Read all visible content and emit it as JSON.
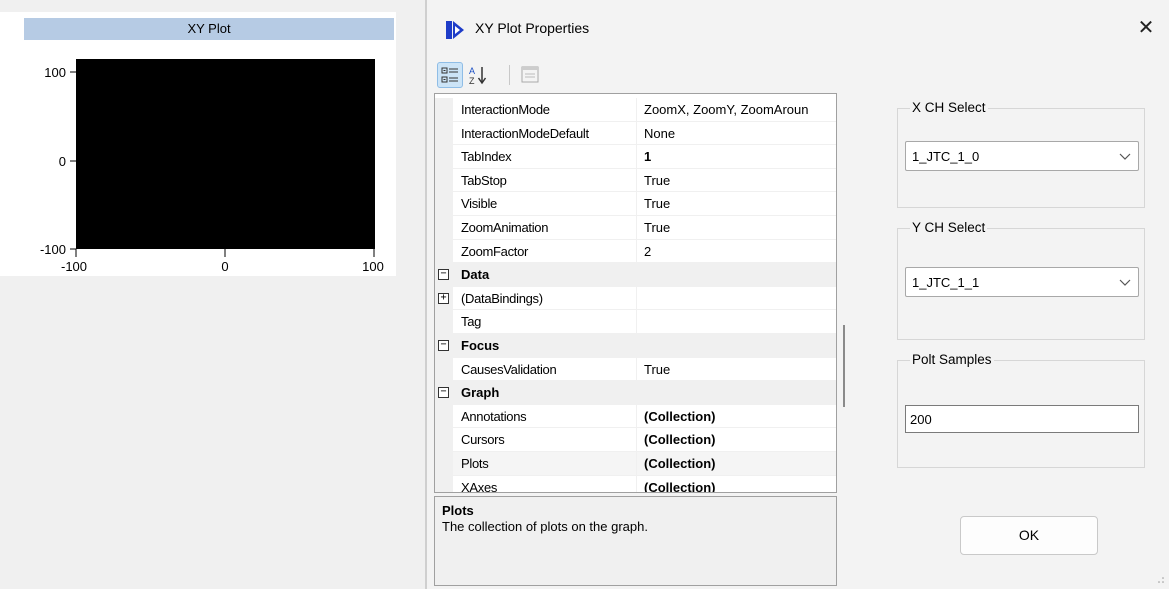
{
  "plot": {
    "title": "XY Plot",
    "y_ticks": [
      "100",
      "0",
      "-100"
    ],
    "x_ticks": [
      "-100",
      "0",
      "100"
    ],
    "plot_area_color": "#000000",
    "title_bar_color": "#b6cbe4"
  },
  "dialog": {
    "title": "XY Plot Properties",
    "close_label": "✕",
    "accent_icon_color": "#1e3cc8"
  },
  "grid": {
    "rows": [
      {
        "name": "InteractionMode",
        "value": "ZoomX, ZoomY, ZoomAroun"
      },
      {
        "name": "InteractionModeDefault",
        "value": "None"
      },
      {
        "name": "TabIndex",
        "value": "1"
      },
      {
        "name": "TabStop",
        "value": "True"
      },
      {
        "name": "Visible",
        "value": "True"
      },
      {
        "name": "ZoomAnimation",
        "value": "True"
      },
      {
        "name": "ZoomFactor",
        "value": "2"
      },
      {
        "name": "Data",
        "value": ""
      },
      {
        "name": "(DataBindings)",
        "value": ""
      },
      {
        "name": "Tag",
        "value": ""
      },
      {
        "name": "Focus",
        "value": ""
      },
      {
        "name": "CausesValidation",
        "value": "True"
      },
      {
        "name": "Graph",
        "value": ""
      },
      {
        "name": "Annotations",
        "value": "(Collection)"
      },
      {
        "name": "Cursors",
        "value": "(Collection)"
      },
      {
        "name": "Plots",
        "value": "(Collection)"
      },
      {
        "name": "XAxes",
        "value": "(Collection)"
      }
    ],
    "expander_collapse": "−",
    "expander_expand": "+"
  },
  "description": {
    "title": "Plots",
    "text": "The collection of plots on the graph."
  },
  "x_select": {
    "label": "X CH Select",
    "value": "1_JTC_1_0"
  },
  "y_select": {
    "label": "Y CH Select",
    "value": "1_JTC_1_1"
  },
  "samples": {
    "label": "Polt Samples",
    "value": "200"
  },
  "ok_label": "OK"
}
